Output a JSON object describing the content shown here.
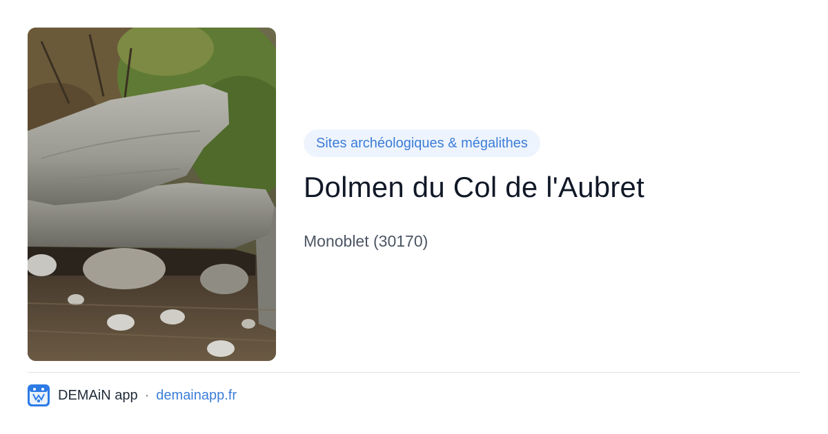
{
  "place": {
    "category": "Sites archéologiques & mégalithes",
    "name": "Dolmen du Col de l'Aubret",
    "location": "Monoblet (30170)"
  },
  "footer": {
    "app_name": "DEMAiN app",
    "separator": "·",
    "url": "demainapp.fr"
  },
  "colors": {
    "accent": "#3b7dd8",
    "badge_bg": "#eef4fd",
    "title": "#111827",
    "subtitle": "#4b5563"
  },
  "icons": {
    "logo": "demain-app-logo-icon"
  }
}
